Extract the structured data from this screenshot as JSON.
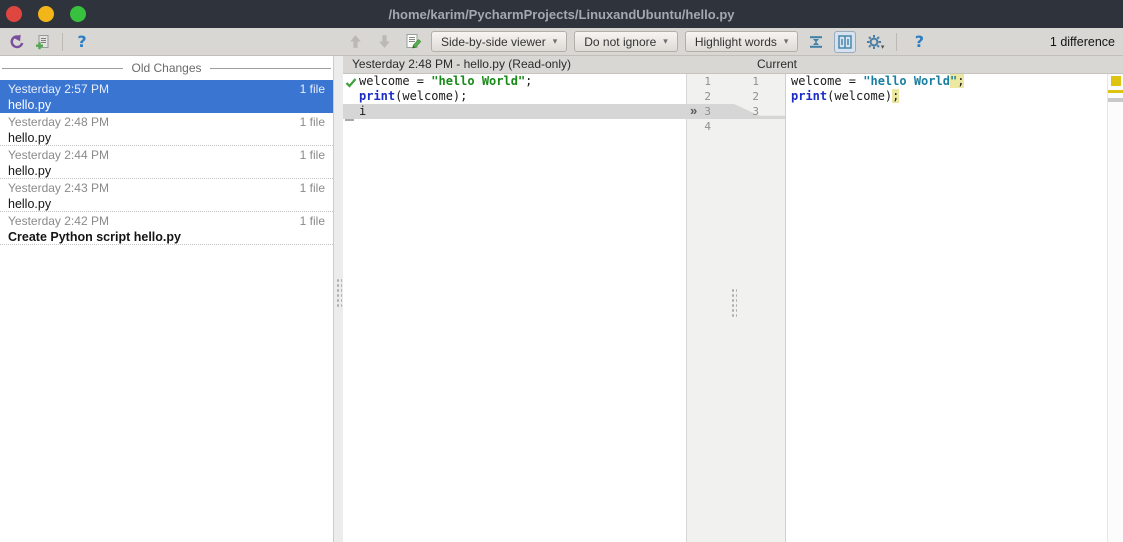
{
  "titlebar": {
    "title": "/home/karim/PycharmProjects/LinuxandUbuntu/hello.py"
  },
  "toolbar": {
    "viewer_dropdown": "Side-by-side viewer",
    "ignore_dropdown": "Do not ignore",
    "highlight_dropdown": "Highlight words",
    "difference_count": "1 difference",
    "help_label": "?",
    "dropdown_caret": "▾"
  },
  "history": {
    "header": "Old Changes",
    "items": [
      {
        "time": "Yesterday 2:57 PM",
        "name": "hello.py",
        "count": "1 file",
        "selected": true,
        "bold": false
      },
      {
        "time": "Yesterday 2:48 PM",
        "name": "hello.py",
        "count": "1 file",
        "selected": false,
        "bold": false
      },
      {
        "time": "Yesterday 2:44 PM",
        "name": "hello.py",
        "count": "1 file",
        "selected": false,
        "bold": false
      },
      {
        "time": "Yesterday 2:43 PM",
        "name": "hello.py",
        "count": "1 file",
        "selected": false,
        "bold": false
      },
      {
        "time": "Yesterday 2:42 PM",
        "name": "Create Python script hello.py",
        "count": "1 file",
        "selected": false,
        "bold": true
      }
    ]
  },
  "diff": {
    "left_title": "Yesterday 2:48 PM - hello.py (Read-only)",
    "right_title": "Current",
    "chevron": "»",
    "left_gutter_numbers": [
      "1",
      "2",
      "3",
      "4"
    ],
    "right_gutter_numbers": [
      "1",
      "2",
      "3"
    ],
    "left_lines": [
      {
        "segments": [
          {
            "t": "welcome = ",
            "c": "plain"
          },
          {
            "t": "\"hello World\"",
            "c": "str1"
          },
          {
            "t": ";",
            "c": "plain"
          }
        ]
      },
      {
        "segments": [
          {
            "t": "print",
            "c": "kw"
          },
          {
            "t": "(welcome);",
            "c": "plain"
          }
        ]
      },
      {
        "changed": true,
        "segments": [
          {
            "t": "i",
            "c": "plain"
          }
        ]
      },
      {
        "segments": []
      }
    ],
    "right_lines": [
      {
        "segments": [
          {
            "t": "welcome = ",
            "c": "plain"
          },
          {
            "t": "\"hello World",
            "c": "str2"
          },
          {
            "t": "\"",
            "c": "str2",
            "warn": true
          },
          {
            "t": ";",
            "c": "plain",
            "warn": true
          }
        ]
      },
      {
        "segments": [
          {
            "t": "print",
            "c": "kw"
          },
          {
            "t": "(welcome)",
            "c": "plain"
          },
          {
            "t": ";",
            "c": "plain",
            "warn": true
          }
        ]
      },
      {
        "segments": []
      }
    ]
  },
  "colors": {
    "selection_blue": "#3b75d2",
    "string_old": "#178a17",
    "string_new": "#187fa1",
    "keyword_blue": "#1b2cc7",
    "warning_yellow": "#ddc413",
    "diff_band_gray": "#d6d6d6",
    "titlebar_dark": "#2f333c",
    "traffic_red": "#df4640",
    "traffic_amber": "#f3b618",
    "traffic_green": "#37c13f"
  }
}
